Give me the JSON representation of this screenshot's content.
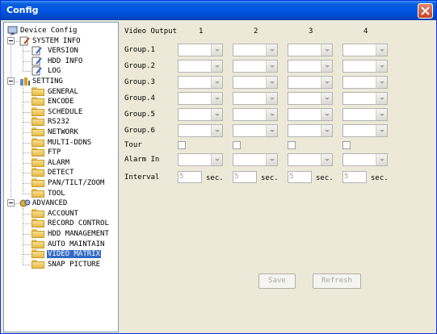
{
  "window": {
    "title": "Config"
  },
  "tree": {
    "root": "Device Config",
    "system_info": {
      "label": "SYSTEM INFO",
      "items": [
        "VERSION",
        "HDD INFO",
        "LOG"
      ]
    },
    "setting": {
      "label": "SETTING",
      "items": [
        "GENERAL",
        "ENCODE",
        "SCHEDULE",
        "RS232",
        "NETWORK",
        "MULTI-DDNS",
        "FTP",
        "ALARM",
        "DETECT",
        "PAN/TILT/ZOOM",
        "TOOL"
      ]
    },
    "advanced": {
      "label": "ADVANCED",
      "items": [
        "ACCOUNT",
        "RECORD CONTROL",
        "HDD MANAGEMENT",
        "AUTO MAINTAIN",
        "VIDEO MATRIX",
        "SNAP PICTURE"
      ]
    },
    "selected": "VIDEO MATRIX"
  },
  "matrix": {
    "header_label": "Video Output",
    "columns": [
      "1",
      "2",
      "3",
      "4"
    ],
    "groups": [
      "Group.1",
      "Group.2",
      "Group.3",
      "Group.4",
      "Group.5",
      "Group.6"
    ],
    "tour_label": "Tour",
    "alarm_in_label": "Alarm In",
    "interval_label": "Interval",
    "interval_values": [
      "5",
      "5",
      "5",
      "5"
    ],
    "interval_unit": "sec."
  },
  "buttons": {
    "save": "Save",
    "refresh": "Refresh"
  }
}
